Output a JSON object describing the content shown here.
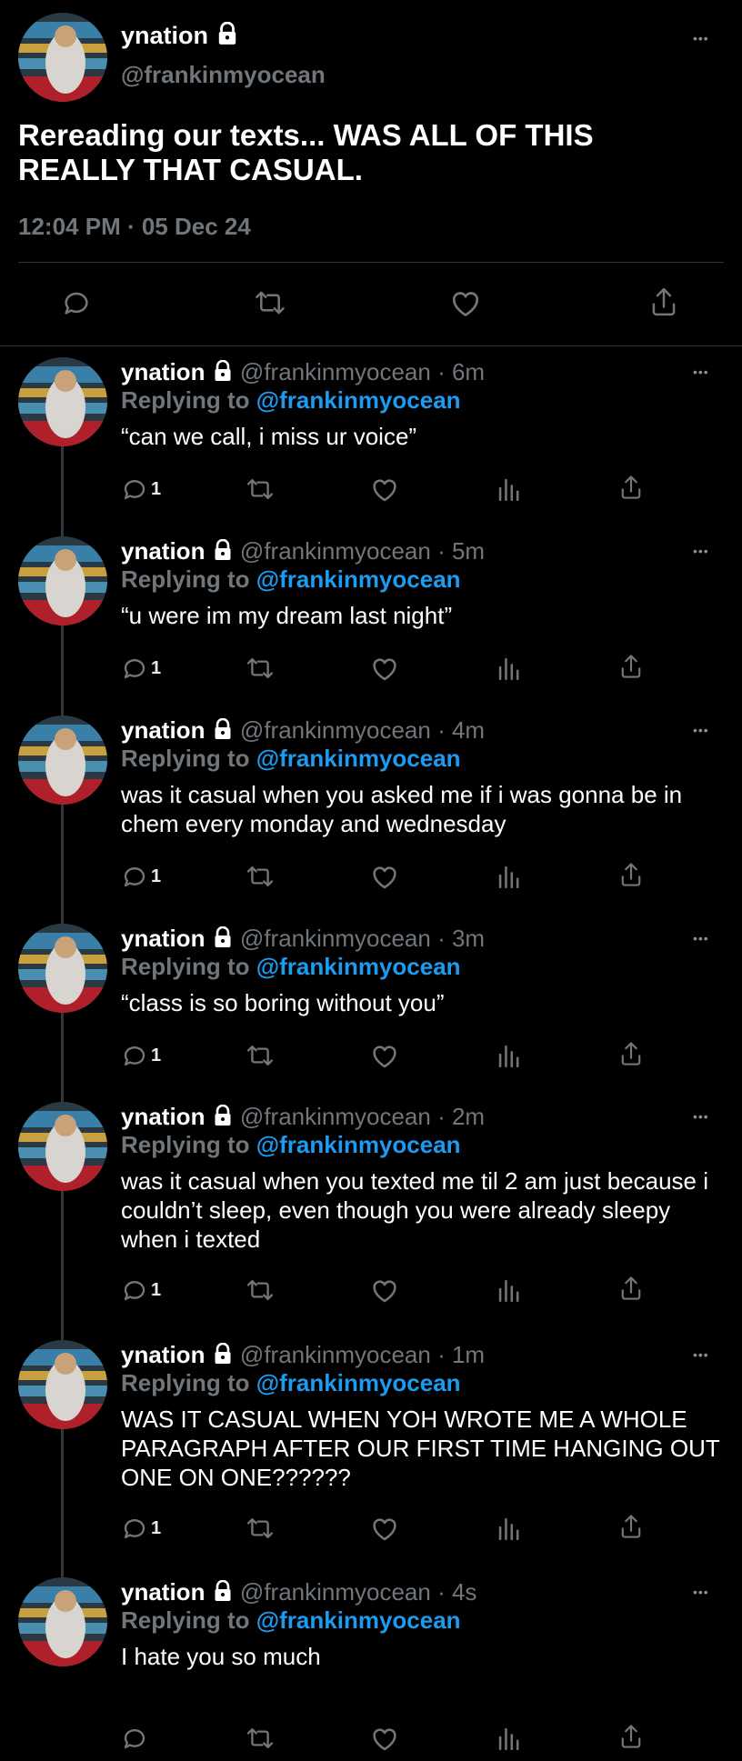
{
  "main": {
    "name": "ynation",
    "handle": "@frankinmyocean",
    "text": "Rereading our texts... WAS ALL OF THIS REALLY THAT CASUAL.",
    "timestamp": "12:04 PM · 05 Dec 24"
  },
  "icons": {
    "reply": "reply-icon",
    "retweet": "retweet-icon",
    "like": "heart-icon",
    "views": "analytics-icon",
    "share": "share-icon",
    "more": "more-icon",
    "lock": "lock-icon"
  },
  "colors": {
    "background": "#000000",
    "accent": "#1d9bf0",
    "muted": "#71767b"
  },
  "replying_label": "Replying to",
  "more_label": "•••",
  "replies": [
    {
      "name": "ynation",
      "handle_time": "@frankinmyocean · 6m",
      "replying_to": "@frankinmyocean",
      "text": "“can we call, i miss ur voice”",
      "reply_count": "1"
    },
    {
      "name": "ynation",
      "handle_time": "@frankinmyocean · 5m",
      "replying_to": "@frankinmyocean",
      "text": "“u were im my dream last night”",
      "reply_count": "1"
    },
    {
      "name": "ynation",
      "handle_time": "@frankinmyocean · 4m",
      "replying_to": "@frankinmyocean",
      "text": "was it casual when you asked me if i was gonna be in chem every monday and wednesday",
      "reply_count": "1"
    },
    {
      "name": "ynation",
      "handle_time": "@frankinmyocean · 3m",
      "replying_to": "@frankinmyocean",
      "text": "“class is so boring without you”",
      "reply_count": "1"
    },
    {
      "name": "ynation",
      "handle_time": "@frankinmyocean · 2m",
      "replying_to": "@frankinmyocean",
      "text": "was it casual when you texted me til 2 am just because i couldn’t sleep, even though you were already sleepy when i texted",
      "reply_count": "1"
    },
    {
      "name": "ynation",
      "handle_time": "@frankinmyocean · 1m",
      "replying_to": "@frankinmyocean",
      "text": "WAS IT CASUAL WHEN YOH WROTE ME A WHOLE PARAGRAPH AFTER OUR FIRST TIME HANGING OUT ONE ON ONE??????",
      "reply_count": "1"
    },
    {
      "name": "ynation",
      "handle_time": "@frankinmyocean · 4s",
      "replying_to": "@frankinmyocean",
      "text": "I hate you so much",
      "reply_count": ""
    }
  ]
}
